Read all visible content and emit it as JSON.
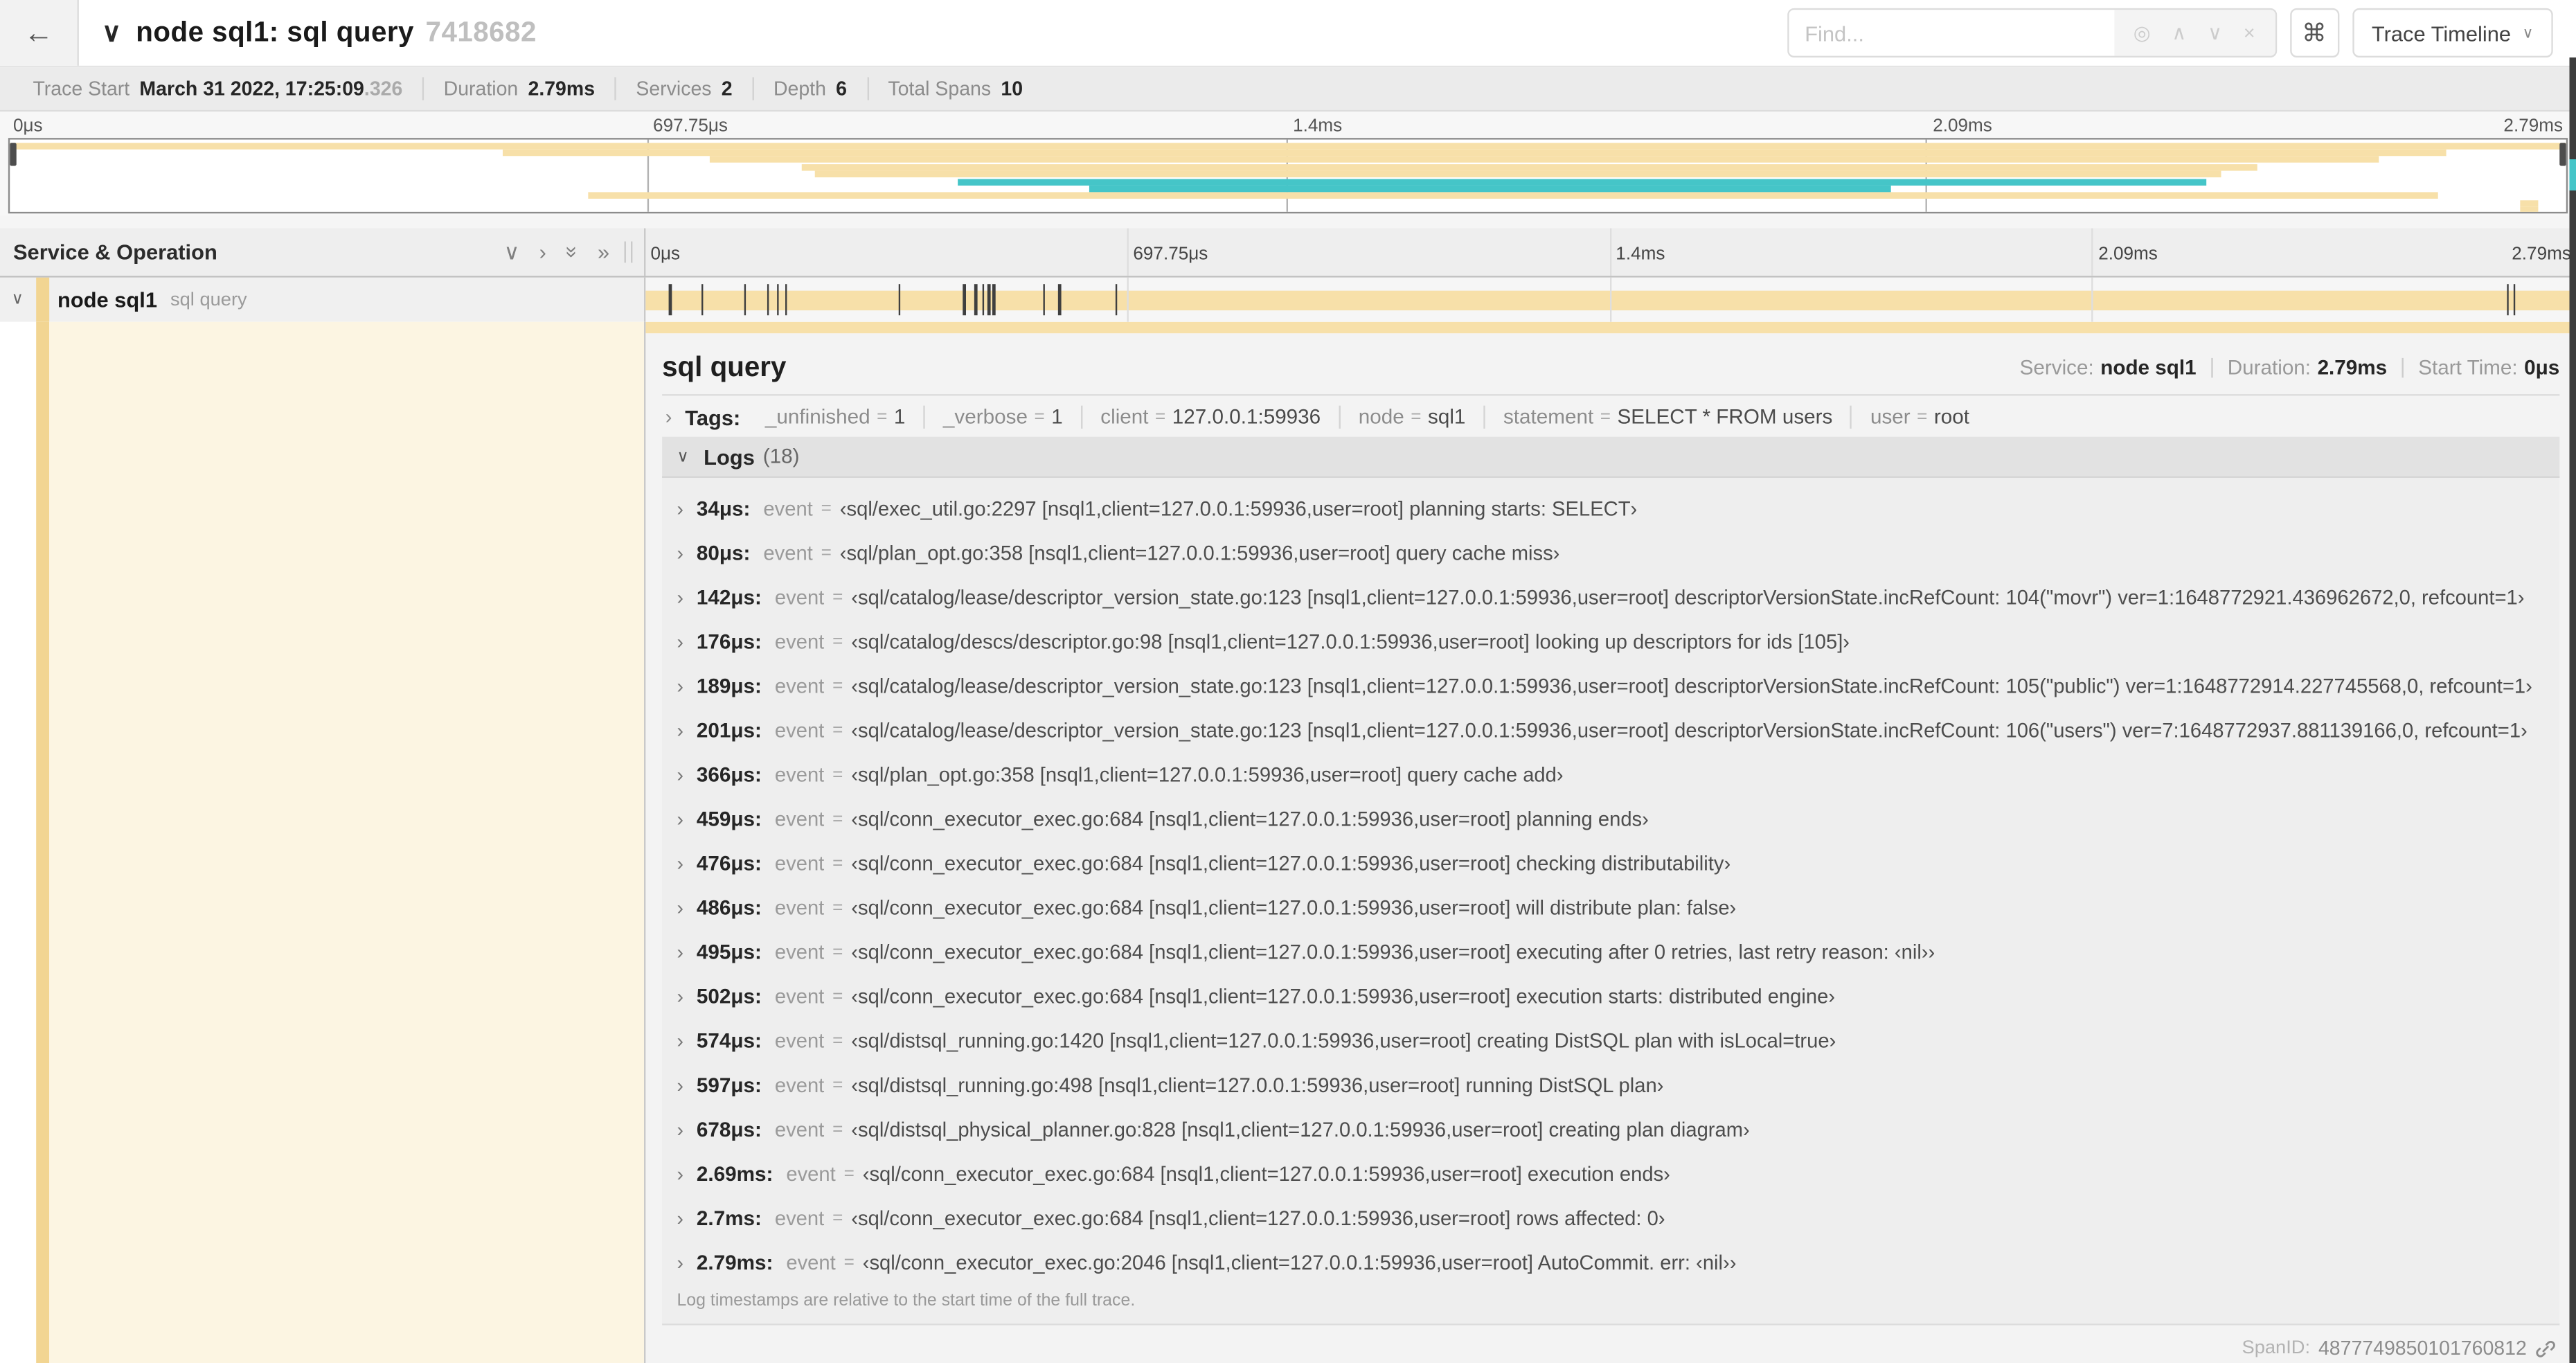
{
  "colors": {
    "tan": "#F7E0A9",
    "stripe": "#F2D592",
    "cream": "#FCF5E2",
    "teal": "#45C5C8"
  },
  "header": {
    "back_icon": "←",
    "collapse_icon": "∨",
    "title": "node sql1: sql query",
    "trace_id_short": "7418682",
    "find_placeholder": "Find...",
    "find_icons": [
      "◎",
      "∧",
      "∨",
      "×"
    ],
    "shortcut_icon": "⌘",
    "view_selector": "Trace Timeline",
    "view_caret": "∨"
  },
  "trace_info": {
    "items": [
      {
        "label": "Trace Start",
        "value": "March 31 2022, 17:25:09",
        "suffix": ".326"
      },
      {
        "label": "Duration",
        "value": "2.79ms"
      },
      {
        "label": "Services",
        "value": "2"
      },
      {
        "label": "Depth",
        "value": "6"
      },
      {
        "label": "Total Spans",
        "value": "10"
      }
    ]
  },
  "timeline": {
    "ticks": [
      "0μs",
      "697.75μs",
      "1.4ms",
      "2.09ms",
      "2.79ms"
    ],
    "duration_us": 2790
  },
  "minimap": {
    "spans": [
      {
        "start": 0,
        "end": 100,
        "color": "tan"
      },
      {
        "start": 19.3,
        "end": 95.3,
        "color": "tan"
      },
      {
        "start": 27.4,
        "end": 92.7,
        "color": "tan"
      },
      {
        "start": 31.0,
        "end": 87.9,
        "color": "tan"
      },
      {
        "start": 31.5,
        "end": 86.5,
        "color": "tan"
      },
      {
        "start": 37.1,
        "end": 85.9,
        "color": "teal"
      },
      {
        "start": 42.2,
        "end": 73.6,
        "color": "teal"
      },
      {
        "start": 22.6,
        "end": 95.0,
        "color": "tan"
      },
      {
        "start": 98.2,
        "end": 98.9,
        "color": "tan"
      },
      {
        "start": 98.2,
        "end": 98.9,
        "color": "tan"
      }
    ]
  },
  "span_list": {
    "header": "Service & Operation",
    "collapse_one_icon": "∨",
    "expand_one_icon": "›",
    "collapse_all_icon": "»",
    "expand_all_icon": "»",
    "row": {
      "chevron": "∨",
      "service": "node sql1",
      "operation": "sql query"
    },
    "log_marks_us": [
      34,
      80,
      142,
      176,
      189,
      201,
      366,
      459,
      476,
      486,
      495,
      502,
      574,
      597,
      678,
      2690,
      2700,
      2790
    ]
  },
  "detail": {
    "operation": "sql query",
    "meta": [
      {
        "label": "Service:",
        "value": "node sql1"
      },
      {
        "label": "Duration:",
        "value": "2.79ms"
      },
      {
        "label": "Start Time:",
        "value": "0μs"
      }
    ],
    "tags_chevron": "›",
    "tags_label": "Tags:",
    "tags": [
      {
        "key": "_unfinished",
        "value": "1"
      },
      {
        "key": "_verbose",
        "value": "1"
      },
      {
        "key": "client",
        "value": "127.0.0.1:59936"
      },
      {
        "key": "node",
        "value": "sql1"
      },
      {
        "key": "statement",
        "value": "SELECT * FROM users"
      },
      {
        "key": "user",
        "value": "root"
      }
    ],
    "logs_chevron": "∨",
    "logs_label": "Logs",
    "logs_count": "(18)",
    "logs": [
      {
        "time": "34μs:",
        "key": "event",
        "value": "‹sql/exec_util.go:2297 [nsql1,client=127.0.0.1:59936,user=root] planning starts: SELECT›"
      },
      {
        "time": "80μs:",
        "key": "event",
        "value": "‹sql/plan_opt.go:358 [nsql1,client=127.0.0.1:59936,user=root] query cache miss›"
      },
      {
        "time": "142μs:",
        "key": "event",
        "value": "‹sql/catalog/lease/descriptor_version_state.go:123 [nsql1,client=127.0.0.1:59936,user=root] descriptorVersionState.incRefCount: 104(\"movr\") ver=1:1648772921.436962672,0, refcount=1›"
      },
      {
        "time": "176μs:",
        "key": "event",
        "value": "‹sql/catalog/descs/descriptor.go:98 [nsql1,client=127.0.0.1:59936,user=root] looking up descriptors for ids [105]›"
      },
      {
        "time": "189μs:",
        "key": "event",
        "value": "‹sql/catalog/lease/descriptor_version_state.go:123 [nsql1,client=127.0.0.1:59936,user=root] descriptorVersionState.incRefCount: 105(\"public\") ver=1:1648772914.227745568,0, refcount=1›"
      },
      {
        "time": "201μs:",
        "key": "event",
        "value": "‹sql/catalog/lease/descriptor_version_state.go:123 [nsql1,client=127.0.0.1:59936,user=root] descriptorVersionState.incRefCount: 106(\"users\") ver=7:1648772937.881139166,0, refcount=1›"
      },
      {
        "time": "366μs:",
        "key": "event",
        "value": "‹sql/plan_opt.go:358 [nsql1,client=127.0.0.1:59936,user=root] query cache add›"
      },
      {
        "time": "459μs:",
        "key": "event",
        "value": "‹sql/conn_executor_exec.go:684 [nsql1,client=127.0.0.1:59936,user=root] planning ends›"
      },
      {
        "time": "476μs:",
        "key": "event",
        "value": "‹sql/conn_executor_exec.go:684 [nsql1,client=127.0.0.1:59936,user=root] checking distributability›"
      },
      {
        "time": "486μs:",
        "key": "event",
        "value": "‹sql/conn_executor_exec.go:684 [nsql1,client=127.0.0.1:59936,user=root] will distribute plan: false›"
      },
      {
        "time": "495μs:",
        "key": "event",
        "value": "‹sql/conn_executor_exec.go:684 [nsql1,client=127.0.0.1:59936,user=root] executing after 0 retries, last retry reason: ‹nil››"
      },
      {
        "time": "502μs:",
        "key": "event",
        "value": "‹sql/conn_executor_exec.go:684 [nsql1,client=127.0.0.1:59936,user=root] execution starts: distributed engine›"
      },
      {
        "time": "574μs:",
        "key": "event",
        "value": "‹sql/distsql_running.go:1420 [nsql1,client=127.0.0.1:59936,user=root] creating DistSQL plan with isLocal=true›"
      },
      {
        "time": "597μs:",
        "key": "event",
        "value": "‹sql/distsql_running.go:498 [nsql1,client=127.0.0.1:59936,user=root] running DistSQL plan›"
      },
      {
        "time": "678μs:",
        "key": "event",
        "value": "‹sql/distsql_physical_planner.go:828 [nsql1,client=127.0.0.1:59936,user=root] creating plan diagram›"
      },
      {
        "time": "2.69ms:",
        "key": "event",
        "value": "‹sql/conn_executor_exec.go:684 [nsql1,client=127.0.0.1:59936,user=root] execution ends›"
      },
      {
        "time": "2.7ms:",
        "key": "event",
        "value": "‹sql/conn_executor_exec.go:684 [nsql1,client=127.0.0.1:59936,user=root] rows affected: 0›"
      },
      {
        "time": "2.79ms:",
        "key": "event",
        "value": "‹sql/conn_executor_exec.go:2046 [nsql1,client=127.0.0.1:59936,user=root] AutoCommit. err: ‹nil››"
      }
    ],
    "footer_note": "Log timestamps are relative to the start time of the full trace.",
    "span_id_label": "SpanID:",
    "span_id": "4877749850101760812"
  }
}
